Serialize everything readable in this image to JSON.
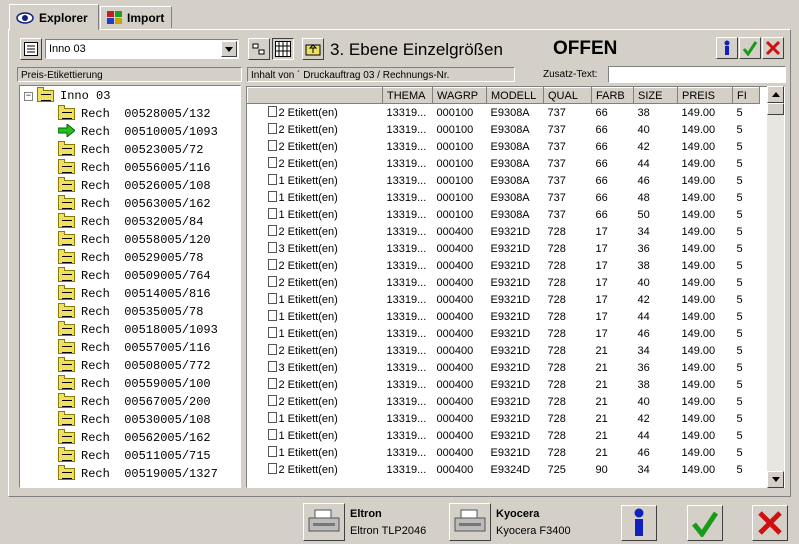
{
  "tabs": [
    {
      "label": "Explorer",
      "icon": "eye-icon"
    },
    {
      "label": "Import",
      "icon": "grid-color-icon"
    }
  ],
  "toolbar": {
    "combo_value": "Inno 03",
    "title": "3. Ebene Einzelgrößen",
    "status": "OFFEN"
  },
  "labels": {
    "left_header": "Preis-Etikettierung",
    "content_header": "Inhalt von ´ Druckauftrag 03 /  Rechnungs-Nr.",
    "zusatz_label": "Zusatz-Text:",
    "zusatz_value": ""
  },
  "tree": {
    "root": "Inno 03",
    "items": [
      "Rech  00528005/132",
      "Rech  00510005/1093",
      "Rech  00523005/72",
      "Rech  00556005/116",
      "Rech  00526005/108",
      "Rech  00563005/162",
      "Rech  00532005/84",
      "Rech  00558005/120",
      "Rech  00529005/78",
      "Rech  00509005/764",
      "Rech  00514005/816",
      "Rech  00535005/78",
      "Rech  00518005/1093",
      "Rech  00557005/116",
      "Rech  00508005/772",
      "Rech  00559005/100",
      "Rech  00567005/200",
      "Rech  00530005/108",
      "Rech  00562005/162",
      "Rech  00511005/715",
      "Rech  00519005/1327"
    ]
  },
  "table": {
    "columns": [
      "",
      "THEMA",
      "WAGRP",
      "MODELL",
      "QUAL",
      "FARB",
      "SIZE",
      "PREIS",
      "FI"
    ],
    "rows": [
      [
        "2 Etikett(en)",
        "13319...",
        "000100",
        "E9308A",
        "737",
        "66",
        "38",
        "149.00",
        "5"
      ],
      [
        "2 Etikett(en)",
        "13319...",
        "000100",
        "E9308A",
        "737",
        "66",
        "40",
        "149.00",
        "5"
      ],
      [
        "2 Etikett(en)",
        "13319...",
        "000100",
        "E9308A",
        "737",
        "66",
        "42",
        "149.00",
        "5"
      ],
      [
        "2 Etikett(en)",
        "13319...",
        "000100",
        "E9308A",
        "737",
        "66",
        "44",
        "149.00",
        "5"
      ],
      [
        "1 Etikett(en)",
        "13319...",
        "000100",
        "E9308A",
        "737",
        "66",
        "46",
        "149.00",
        "5"
      ],
      [
        "1 Etikett(en)",
        "13319...",
        "000100",
        "E9308A",
        "737",
        "66",
        "48",
        "149.00",
        "5"
      ],
      [
        "1 Etikett(en)",
        "13319...",
        "000100",
        "E9308A",
        "737",
        "66",
        "50",
        "149.00",
        "5"
      ],
      [
        "2 Etikett(en)",
        "13319...",
        "000400",
        "E9321D",
        "728",
        "17",
        "34",
        "149.00",
        "5"
      ],
      [
        "3 Etikett(en)",
        "13319...",
        "000400",
        "E9321D",
        "728",
        "17",
        "36",
        "149.00",
        "5"
      ],
      [
        "2 Etikett(en)",
        "13319...",
        "000400",
        "E9321D",
        "728",
        "17",
        "38",
        "149.00",
        "5"
      ],
      [
        "2 Etikett(en)",
        "13319...",
        "000400",
        "E9321D",
        "728",
        "17",
        "40",
        "149.00",
        "5"
      ],
      [
        "1 Etikett(en)",
        "13319...",
        "000400",
        "E9321D",
        "728",
        "17",
        "42",
        "149.00",
        "5"
      ],
      [
        "1 Etikett(en)",
        "13319...",
        "000400",
        "E9321D",
        "728",
        "17",
        "44",
        "149.00",
        "5"
      ],
      [
        "1 Etikett(en)",
        "13319...",
        "000400",
        "E9321D",
        "728",
        "17",
        "46",
        "149.00",
        "5"
      ],
      [
        "2 Etikett(en)",
        "13319...",
        "000400",
        "E9321D",
        "728",
        "21",
        "34",
        "149.00",
        "5"
      ],
      [
        "3 Etikett(en)",
        "13319...",
        "000400",
        "E9321D",
        "728",
        "21",
        "36",
        "149.00",
        "5"
      ],
      [
        "2 Etikett(en)",
        "13319...",
        "000400",
        "E9321D",
        "728",
        "21",
        "38",
        "149.00",
        "5"
      ],
      [
        "2 Etikett(en)",
        "13319...",
        "000400",
        "E9321D",
        "728",
        "21",
        "40",
        "149.00",
        "5"
      ],
      [
        "1 Etikett(en)",
        "13319...",
        "000400",
        "E9321D",
        "728",
        "21",
        "42",
        "149.00",
        "5"
      ],
      [
        "1 Etikett(en)",
        "13319...",
        "000400",
        "E9321D",
        "728",
        "21",
        "44",
        "149.00",
        "5"
      ],
      [
        "1 Etikett(en)",
        "13319...",
        "000400",
        "E9321D",
        "728",
        "21",
        "46",
        "149.00",
        "5"
      ],
      [
        "2 Etikett(en)",
        "13319...",
        "000400",
        "E9324D",
        "725",
        "90",
        "34",
        "149.00",
        "5"
      ]
    ]
  },
  "printers": [
    {
      "name": "Eltron",
      "model": "Eltron TLP2046",
      "icon": "printer-icon"
    },
    {
      "name": "Kyocera",
      "model": "Kyocera F3400",
      "icon": "printer-icon"
    }
  ],
  "colors": {
    "ok_green": "#1a9a1a",
    "cancel_red": "#d01010",
    "info_blue": "#1020c0"
  }
}
